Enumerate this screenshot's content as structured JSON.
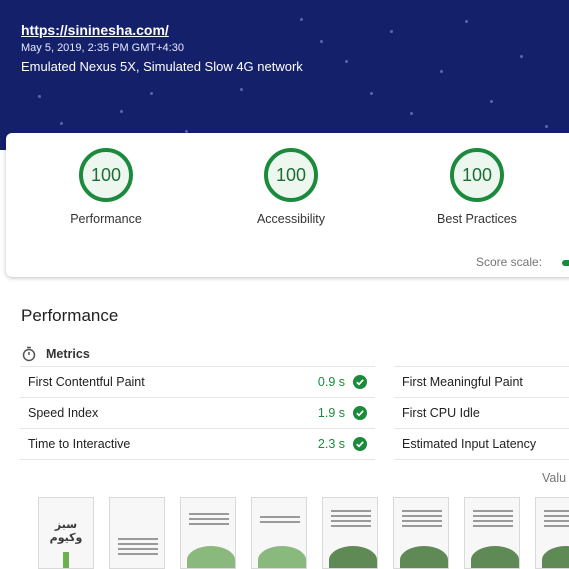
{
  "header": {
    "url": "https://sininesha.com/",
    "date": "May 5, 2019, 2:35 PM GMT+4:30",
    "environment": "Emulated Nexus 5X, Simulated Slow 4G network"
  },
  "scores": [
    {
      "value": "100",
      "label": "Performance"
    },
    {
      "value": "100",
      "label": "Accessibility"
    },
    {
      "value": "100",
      "label": "Best Practices"
    }
  ],
  "score_scale_label": "Score scale:",
  "performance": {
    "title": "Performance",
    "metrics_label": "Metrics",
    "left_metrics": [
      {
        "name": "First Contentful Paint",
        "value": "0.9 s"
      },
      {
        "name": "Speed Index",
        "value": "1.9 s"
      },
      {
        "name": "Time to Interactive",
        "value": "2.3 s"
      }
    ],
    "right_metrics": [
      {
        "name": "First Meaningful Paint"
      },
      {
        "name": "First CPU Idle"
      },
      {
        "name": "Estimated Input Latency"
      }
    ],
    "values_note": "Valu"
  },
  "filmstrip": {
    "logo_text": "سبز وکیوم"
  },
  "colors": {
    "header_bg": "#15206b",
    "pass_green": "#1b8a3c"
  }
}
